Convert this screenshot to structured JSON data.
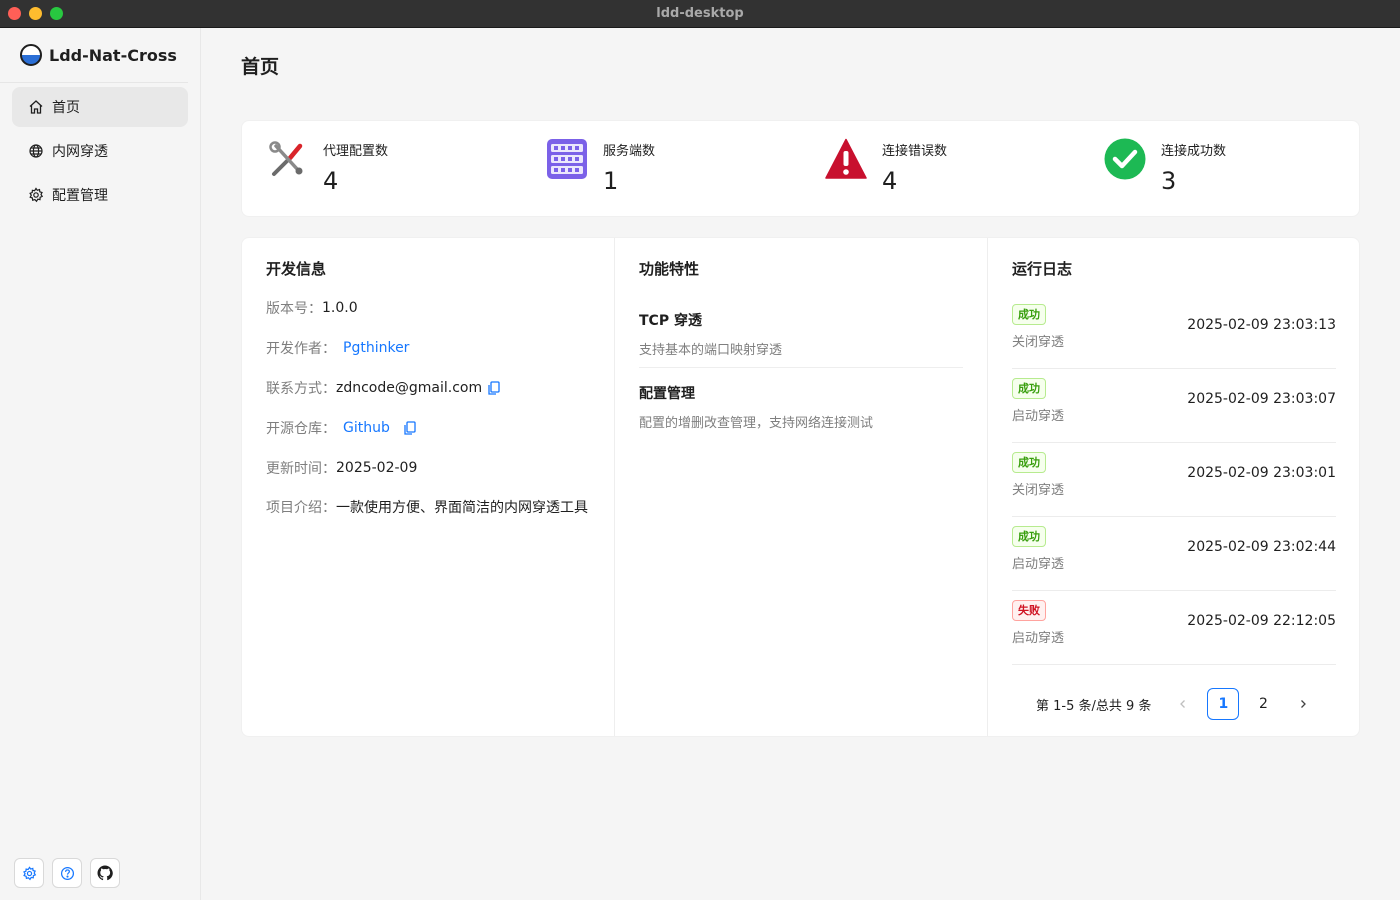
{
  "window": {
    "title": "ldd-desktop"
  },
  "app": {
    "name": "Ldd-Nat-Cross"
  },
  "sidebar": {
    "items": [
      {
        "label": "首页",
        "icon": "home-icon",
        "active": true
      },
      {
        "label": "内网穿透",
        "icon": "globe-icon",
        "active": false
      },
      {
        "label": "配置管理",
        "icon": "gear-icon",
        "active": false
      }
    ],
    "footer": [
      "settings-icon",
      "help-icon",
      "github-icon"
    ]
  },
  "page": {
    "title": "首页"
  },
  "stats": [
    {
      "label": "代理配置数",
      "value": "4",
      "icon": "tools-icon"
    },
    {
      "label": "服务端数",
      "value": "1",
      "icon": "server-icon"
    },
    {
      "label": "连接错误数",
      "value": "4",
      "icon": "warning-icon"
    },
    {
      "label": "连接成功数",
      "value": "3",
      "icon": "check-icon"
    }
  ],
  "dev_info": {
    "title": "开发信息",
    "version_key": "版本号：",
    "version": "1.0.0",
    "author_key": "开发作者：",
    "author": "Pgthinker",
    "contact_key": "联系方式：",
    "contact": "zdncode@gmail.com",
    "repo_key": "开源仓库：",
    "repo": "Github",
    "updated_key": "更新时间：",
    "updated": "2025-02-09",
    "intro_key": "项目介绍：",
    "intro": "一款使用方便、界面简洁的内网穿透工具"
  },
  "features": {
    "title": "功能特性",
    "items": [
      {
        "title": "TCP 穿透",
        "desc": "支持基本的端口映射穿透"
      },
      {
        "title": "配置管理",
        "desc": "配置的增删改查管理，支持网络连接测试"
      }
    ]
  },
  "logs": {
    "title": "运行日志",
    "items": [
      {
        "status": "成功",
        "type": "success",
        "action": "关闭穿透",
        "time": "2025-02-09 23:03:13"
      },
      {
        "status": "成功",
        "type": "success",
        "action": "启动穿透",
        "time": "2025-02-09 23:03:07"
      },
      {
        "status": "成功",
        "type": "success",
        "action": "关闭穿透",
        "time": "2025-02-09 23:03:01"
      },
      {
        "status": "成功",
        "type": "success",
        "action": "启动穿透",
        "time": "2025-02-09 23:02:44"
      },
      {
        "status": "失败",
        "type": "error",
        "action": "启动穿透",
        "time": "2025-02-09 22:12:05"
      }
    ],
    "pagination": {
      "total_text": "第 1-5 条/总共 9 条",
      "pages": [
        "1",
        "2"
      ],
      "current": "1"
    }
  },
  "colors": {
    "accent": "#1677ff",
    "success": "#389e0d",
    "error": "#cf1322"
  }
}
